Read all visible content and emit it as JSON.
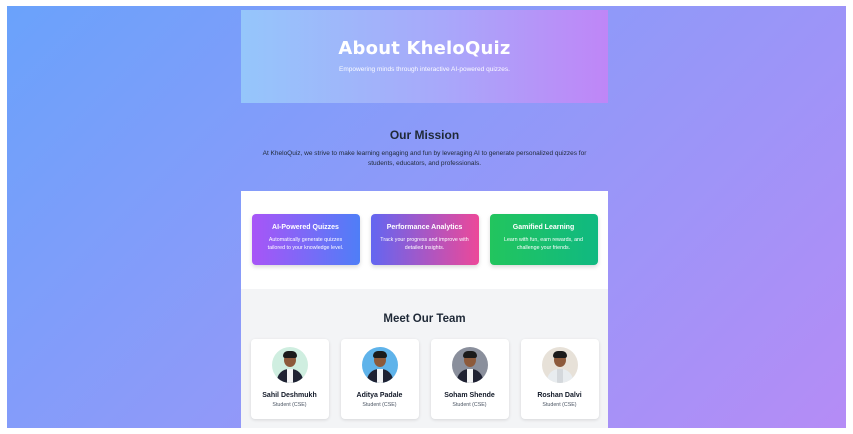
{
  "hero": {
    "title": "About KheloQuiz",
    "subtitle": "Empowering minds through interactive AI-powered quizzes."
  },
  "mission": {
    "title": "Our Mission",
    "text": "At KheloQuiz, we strive to make learning engaging and fun by leveraging AI to generate personalized quizzes for students, educators, and professionals."
  },
  "features": [
    {
      "title": "AI-Powered Quizzes",
      "text": "Automatically generate quizzes tailored to your knowledge level."
    },
    {
      "title": "Performance Analytics",
      "text": "Track your progress and improve with detailed insights."
    },
    {
      "title": "Gamified Learning",
      "text": "Learn with fun, earn rewards, and challenge your friends."
    }
  ],
  "team": {
    "title": "Meet Our Team",
    "members": [
      {
        "name": "Sahil Deshmukh",
        "role": "Student (CSE)"
      },
      {
        "name": "Aditya Padale",
        "role": "Student (CSE)"
      },
      {
        "name": "Soham Shende",
        "role": "Student (CSE)"
      },
      {
        "name": "Roshan Dalvi",
        "role": "Student (CSE)"
      }
    ]
  }
}
